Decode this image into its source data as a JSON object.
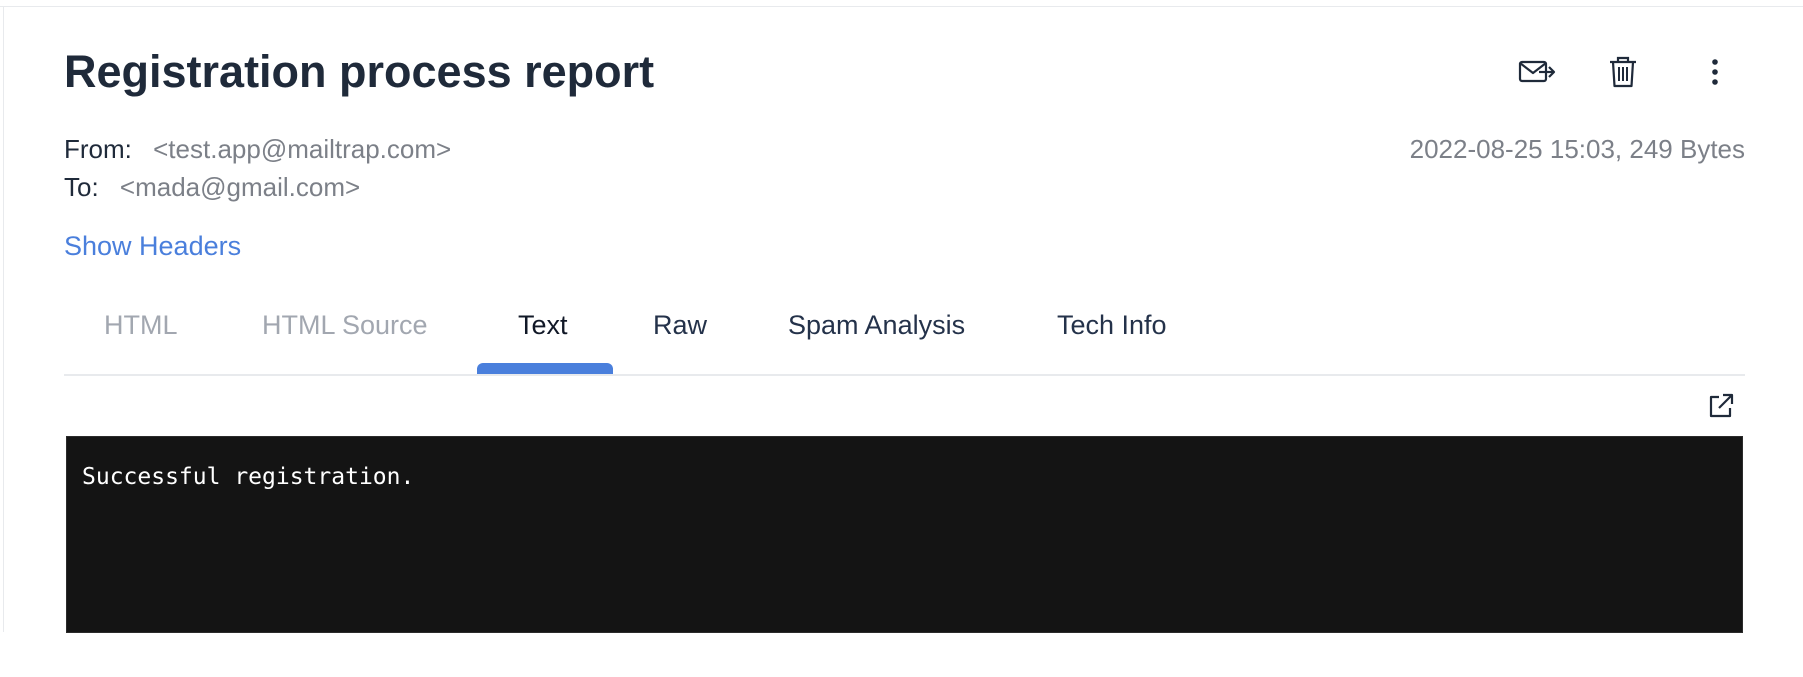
{
  "email": {
    "subject": "Registration process report",
    "from_label": "From:",
    "from_value": "<test.app@mailtrap.com>",
    "to_label": "To:",
    "to_value": "<mada@gmail.com>",
    "date_size": "2022-08-25 15:03, 249 Bytes",
    "show_headers": "Show Headers",
    "body_text": "Successful registration."
  },
  "actions": [
    {
      "name": "forward-email",
      "icon": "envelope-arrow-icon"
    },
    {
      "name": "delete-email",
      "icon": "trash-icon"
    },
    {
      "name": "more-options",
      "icon": "vertical-ellipsis-icon"
    }
  ],
  "tabs": [
    {
      "label": "HTML",
      "state": "disabled"
    },
    {
      "label": "HTML Source",
      "state": "disabled"
    },
    {
      "label": "Text",
      "state": "active"
    },
    {
      "label": "Raw",
      "state": "normal"
    },
    {
      "label": "Spam Analysis",
      "state": "normal"
    },
    {
      "label": "Tech Info",
      "state": "normal"
    }
  ],
  "colors": {
    "title": "#1f2a3a",
    "muted": "#7c8088",
    "link": "#4a7fdc",
    "tab_active_indicator": "#4a7fdc",
    "body_background": "#141414",
    "body_text": "#ffffff"
  }
}
